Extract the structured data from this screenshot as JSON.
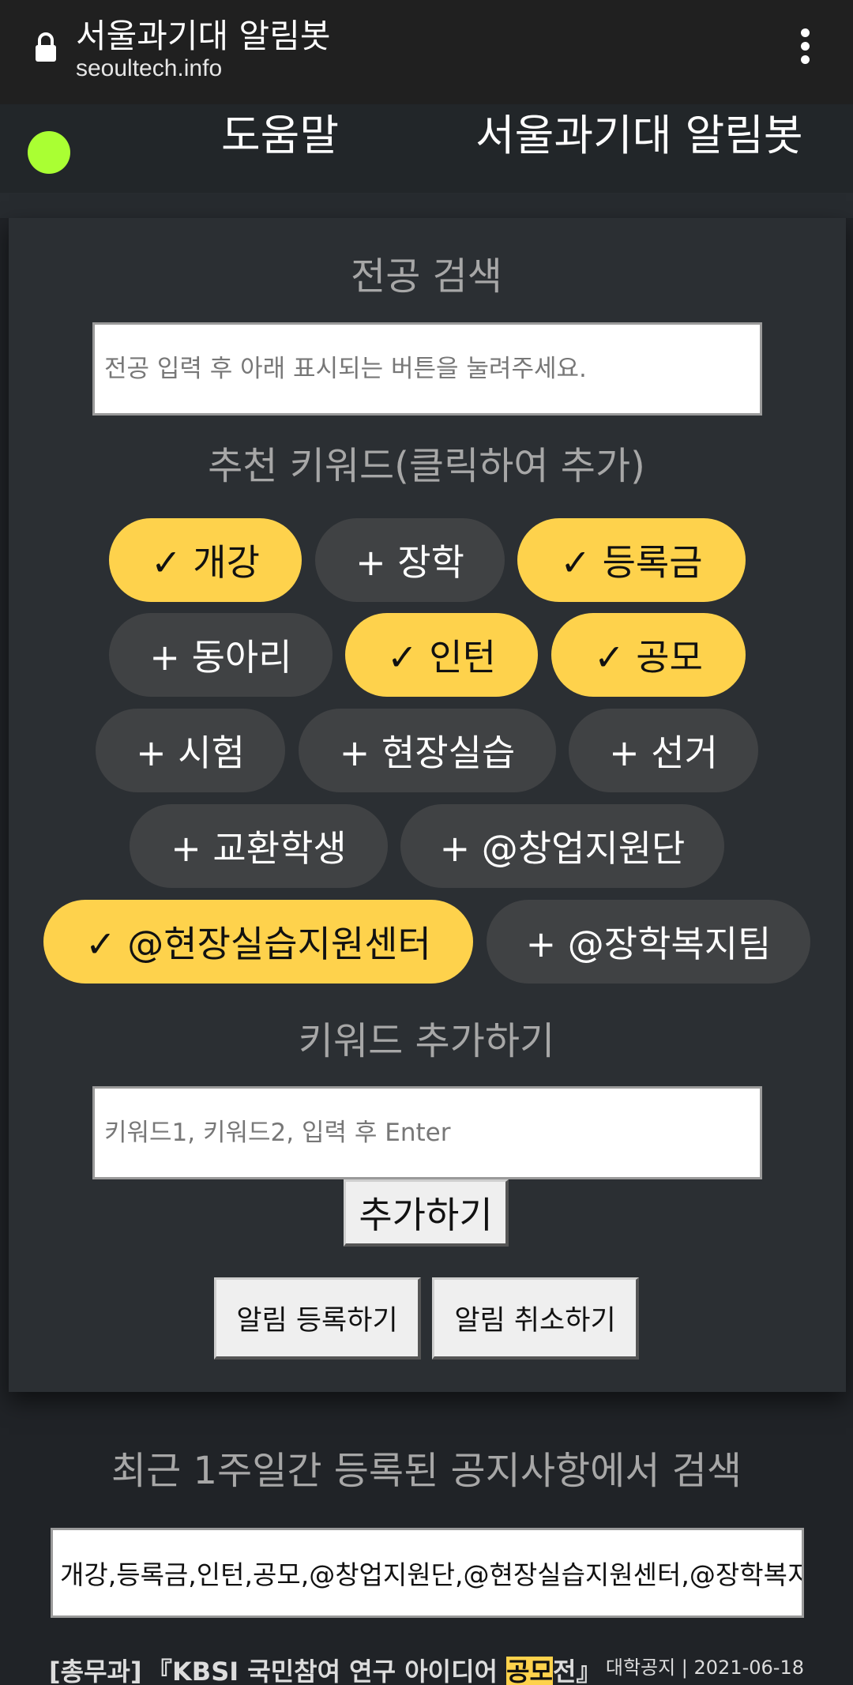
{
  "browser": {
    "title": "서울과기대 알림봇",
    "url": "seoultech.info"
  },
  "header": {
    "help_label": "도움말",
    "brand": "서울과기대 알림봇",
    "status_dot_color": "#aaff33"
  },
  "major_search": {
    "heading": "전공 검색",
    "placeholder": "전공 입력 후 아래 표시되는 버튼을 눌려주세요."
  },
  "recommended": {
    "heading": "추천 키워드(클릭하여 추가)",
    "chips": [
      {
        "label": "✓ 개강",
        "selected": true
      },
      {
        "label": "+ 장학",
        "selected": false
      },
      {
        "label": "✓ 등록금",
        "selected": true
      },
      {
        "label": "+ 동아리",
        "selected": false
      },
      {
        "label": "✓ 인턴",
        "selected": true
      },
      {
        "label": "✓ 공모",
        "selected": true
      },
      {
        "label": "+ 시험",
        "selected": false
      },
      {
        "label": "+ 현장실습",
        "selected": false
      },
      {
        "label": "+ 선거",
        "selected": false
      },
      {
        "label": "+ 교환학생",
        "selected": false
      },
      {
        "label": "+ @창업지원단",
        "selected": false
      },
      {
        "label": "✓ @현장실습지원센터",
        "selected": true
      },
      {
        "label": "+ @장학복지팀",
        "selected": false
      }
    ]
  },
  "add_keyword": {
    "heading": "키워드 추가하기",
    "placeholder": "키워드1, 키워드2, 입력 후 Enter",
    "add_button": "추가하기"
  },
  "actions": {
    "register": "알림 등록하기",
    "cancel": "알림 취소하기"
  },
  "recent": {
    "heading": "최근 1주일간 등록된 공지사항에서 검색",
    "query": "개강,등록금,인턴,공모,@창업지원단,@현장실습지원센터,@장학복지팀",
    "notice": {
      "dept": "[총무과]",
      "title_before": "『KBSI 국민참여 연구 아이디어 ",
      "title_highlight": "공모",
      "title_after": "전』",
      "meta": "대학공지 | 2021-06-18"
    }
  },
  "colors": {
    "selected_chip": "#fed24c",
    "unselected_chip": "#404244",
    "background": "#202327"
  }
}
